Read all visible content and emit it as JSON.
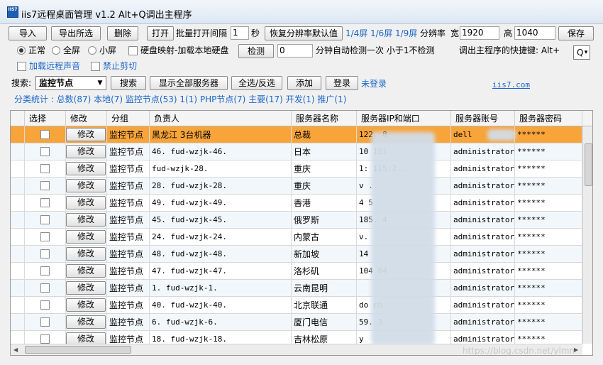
{
  "window": {
    "title": "iis7远程桌面管理 v1.2 Alt+Q调出主程序",
    "icon_text": "IIS7"
  },
  "toolbar1": {
    "import": "导入",
    "export_selected": "导出所选",
    "delete": "删除",
    "open": "打开",
    "batch_open_label": "批量打开间隔",
    "interval_value": "1",
    "seconds": "秒",
    "restore_resolution": "恢复分辨率默认值",
    "split_1_4": "1/4屏",
    "split_1_6": "1/6屏",
    "split_1_9": "1/9屏",
    "resolution_label": "分辨率",
    "width_label": "宽",
    "width_value": "1920",
    "height_label": "高",
    "height_value": "1040",
    "save": "保存"
  },
  "toolbar2": {
    "normal": "正常",
    "fullscreen": "全屏",
    "smallscreen": "小屏",
    "disk_map": "硬盘映射-加载本地硬盘",
    "detect": "检测",
    "detect_value": "0",
    "auto_detect_text": "分钟自动检测一次 小于1不检测",
    "hotkey_label": "调出主程序的快捷键: Alt+",
    "hotkey_value": "Q"
  },
  "toolbar3": {
    "remote_sound": "加载远程声音",
    "no_clipboard": "禁止剪切"
  },
  "toolbar4": {
    "search_label": "搜索:",
    "group_value": "监控节点",
    "search": "搜索",
    "show_all": "显示全部服务器",
    "select_all": "全选/反选",
    "add": "添加",
    "login": "登录",
    "not_logged_in": "未登录",
    "site_link": "iis7.com"
  },
  "stats": "分类统计 : 总数(87) 本地(7) 监控节点(53) 1(1) PHP节点(7) 主要(17) 开发(1) 推广(1)",
  "columns": [
    "选择",
    "修改",
    "分组",
    "负责人",
    "服务器名称",
    "服务器IP和端口",
    "服务器账号",
    "服务器密码"
  ],
  "rows": [
    {
      "edit": "修改",
      "group": "监控节点",
      "owner": "黑龙江 3台机器",
      "name": "总裁",
      "ip": "122.                 8",
      "account": "dell",
      "password": "******"
    },
    {
      "edit": "修改",
      "group": "监控节点",
      "owner": "46. fud-wzjk-46.",
      "name": "日本",
      "ip": "10          151",
      "account": "administrator",
      "password": "******"
    },
    {
      "edit": "修改",
      "group": "监控节点",
      "owner": "fud-wzjk-28.",
      "name": "重庆",
      "ip": "1:          115:2...",
      "account": "administrator",
      "password": "******"
    },
    {
      "edit": "修改",
      "group": "监控节点",
      "owner": "28. fud-wzjk-28.",
      "name": "重庆",
      "ip": "v          ..",
      "account": "administrator",
      "password": "******"
    },
    {
      "edit": "修改",
      "group": "监控节点",
      "owner": "49. fud-wzjk-49.",
      "name": "香港",
      "ip": "4          5",
      "account": "administrator",
      "password": "******"
    },
    {
      "edit": "修改",
      "group": "监控节点",
      "owner": "45. fud-wzjk-45.",
      "name": "俄罗斯",
      "ip": "185.        4",
      "account": "administrator",
      "password": "******"
    },
    {
      "edit": "修改",
      "group": "监控节点",
      "owner": "24. fud-wzjk-24.",
      "name": "内蒙古",
      "ip": "v.",
      "account": "administrator",
      "password": "******"
    },
    {
      "edit": "修改",
      "group": "监控节点",
      "owner": "48. fud-wzjk-48.",
      "name": "新加坡",
      "ip": "14",
      "account": "administrator",
      "password": "******"
    },
    {
      "edit": "修改",
      "group": "监控节点",
      "owner": "47. fud-wzjk-47.",
      "name": "洛杉矶",
      "ip": "104          04",
      "account": "administrator",
      "password": "******"
    },
    {
      "edit": "修改",
      "group": "监控节点",
      "owner": "1. fud-wzjk-1.",
      "name": "云南昆明",
      "ip": "",
      "account": "administrator",
      "password": "******"
    },
    {
      "edit": "修改",
      "group": "监控节点",
      "owner": "40. fud-wzjk-40.",
      "name": "北京联通",
      "ip": "       do    cn",
      "account": "administrator",
      "password": "******"
    },
    {
      "edit": "修改",
      "group": "监控节点",
      "owner": "6. fud-wzjk-6.",
      "name": "厦门电信",
      "ip": "59.          3",
      "account": "administrator",
      "password": "******"
    },
    {
      "edit": "修改",
      "group": "监控节点",
      "owner": "18. fud-wzjk-18.",
      "name": "吉林松原",
      "ip": "y",
      "account": "administrator",
      "password": "******"
    }
  ],
  "watermark": "https://blog.csdn.net/ylmn"
}
